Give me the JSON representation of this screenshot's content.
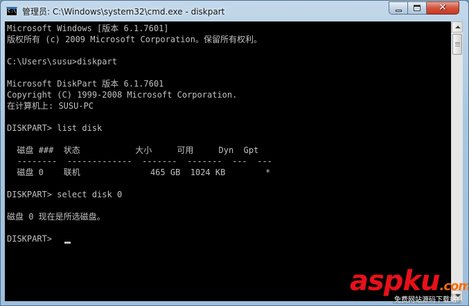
{
  "window": {
    "title": "管理员: C:\\Windows\\system32\\cmd.exe - diskpart",
    "icon": "cmd-console-icon",
    "controls": {
      "minimize": "minimize-icon",
      "maximize": "maximize-icon",
      "close": "✕"
    }
  },
  "console": {
    "lines": [
      "Microsoft Windows [版本 6.1.7601]",
      "版权所有 (c) 2009 Microsoft Corporation。保留所有权利。",
      "",
      "C:\\Users\\susu>diskpart",
      "",
      "Microsoft DiskPart 版本 6.1.7601",
      "Copyright (C) 1999-2008 Microsoft Corporation.",
      "在计算机上: SUSU-PC",
      "",
      "DISKPART> list disk",
      "",
      "  磁盘 ###  状态           大小     可用     Dyn  Gpt",
      "  --------  -------------  -------  -------  ---  ---",
      "  磁盘 0    联机              465 GB  1024 KB        *",
      "",
      "DISKPART> select disk 0",
      "",
      "磁盘 0 现在是所选磁盘。",
      "",
      "DISKPART> "
    ],
    "text_color": "#c0c0c0",
    "background": "#000000"
  },
  "watermark": {
    "logo_main": "aspku",
    "logo_tld": ".com",
    "subtitle": "免费网站源码下载站!"
  }
}
